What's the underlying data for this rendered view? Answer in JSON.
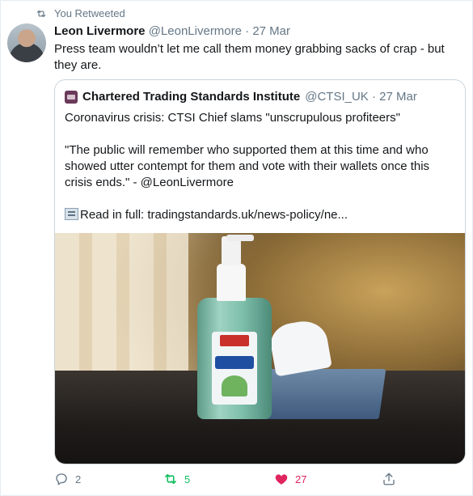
{
  "retweet_banner": {
    "text": "You Retweeted",
    "icon": "retweet-icon"
  },
  "author": {
    "name": "Leon Livermore",
    "handle_date": "@LeonLivermore · 27 Mar",
    "avatar": "avatar"
  },
  "tweet_text": "Press team wouldn’t let me call them money grabbing sacks of crap - but they are.",
  "quote": {
    "name": "Chartered Trading Standards Institute",
    "handle_date": "@CTSI_UK · 27 Mar",
    "headline": "Coronavirus crisis: CTSI Chief slams \"unscrupulous profiteers\"",
    "body": "\"The public will remember who supported them at this time and who showed utter contempt for them and vote with their wallets once this crisis ends.\" - @LeonLivermore",
    "read_more": "Read in full: tradingstandards.uk/news-policy/ne...",
    "image_alt": "Hand sanitizer bottle next to a box of tissues on a table"
  },
  "actions": {
    "reply_count": "2",
    "retweet_count": "5",
    "like_count": "27",
    "retweet_active_color": "#17bf63",
    "like_active_color": "#e0245e"
  }
}
